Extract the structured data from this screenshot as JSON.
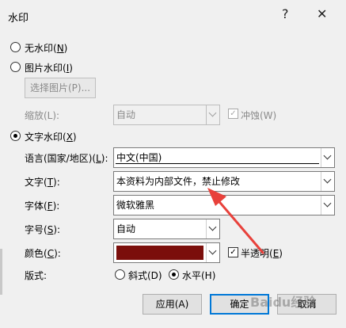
{
  "title": "水印",
  "titlebar": {
    "help": "?",
    "close": "✕"
  },
  "no_watermark": {
    "label": "无水印(",
    "key": "N",
    "tail": ")"
  },
  "picture_watermark": {
    "label": "图片水印(",
    "key": "I",
    "tail": ")"
  },
  "select_picture": {
    "label": "选择图片(P)..."
  },
  "scale": {
    "label": "缩放(L):",
    "value": "自动"
  },
  "washout": {
    "label": "冲蚀(W)"
  },
  "text_watermark": {
    "label": "文字水印(",
    "key": "X",
    "tail": ")"
  },
  "language": {
    "label": "语言(国家/地区)(",
    "key": "L",
    "tail": "):",
    "value": "中文(中国)"
  },
  "text": {
    "label": "文字(",
    "key": "T",
    "tail": "):",
    "value": "本资料为内部文件，禁止修改"
  },
  "font": {
    "label": "字体(",
    "key": "F",
    "tail": "):",
    "value": "微软雅黑"
  },
  "size": {
    "label": "字号(",
    "key": "S",
    "tail": "):",
    "value": "自动"
  },
  "color": {
    "label": "颜色(",
    "key": "C",
    "tail": "):",
    "swatch": "#7b0e0b"
  },
  "semi_transparent": {
    "label": "半透明(",
    "key": "E",
    "tail": ")"
  },
  "layout": {
    "label": "版式:",
    "diagonal": "斜式(D)",
    "horizontal": "水平(H)"
  },
  "buttons": {
    "apply": "应用(A)",
    "ok": "确定",
    "cancel": "取消"
  },
  "watermark_text": "Baidu经验",
  "colors": {
    "accent": "#0078d7",
    "arrow": "#e8413b"
  }
}
